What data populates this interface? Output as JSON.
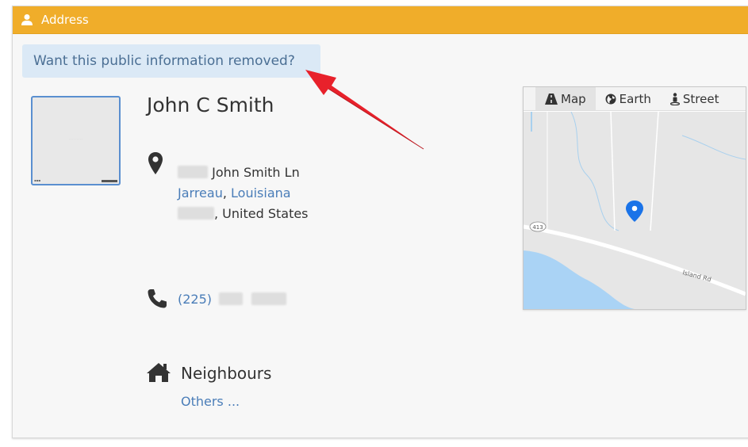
{
  "panel": {
    "title": "Address",
    "title_icon": "user-icon",
    "header_color": "#f0ad2a"
  },
  "removal_banner": {
    "text": "Want this public information removed?"
  },
  "person": {
    "name": "John C Smith"
  },
  "address": {
    "street": "John Smith Ln",
    "city": "Jarreau",
    "separator": ",",
    "state": "Louisiana",
    "country": ", United States"
  },
  "phone": {
    "area_code": "(225)"
  },
  "neighbours": {
    "title": "Neighbours",
    "link": "Others ..."
  },
  "map": {
    "tabs": [
      {
        "label": "Map",
        "icon": "road-icon",
        "active": true
      },
      {
        "label": "Earth",
        "icon": "globe-icon",
        "active": false
      },
      {
        "label": "Street",
        "icon": "street-view-icon",
        "active": false
      }
    ],
    "road_shield": "413",
    "road_label": "Island Rd"
  },
  "colors": {
    "link": "#4a7db8",
    "annotation_arrow": "#e8212b",
    "marker": "#1a73e8"
  }
}
